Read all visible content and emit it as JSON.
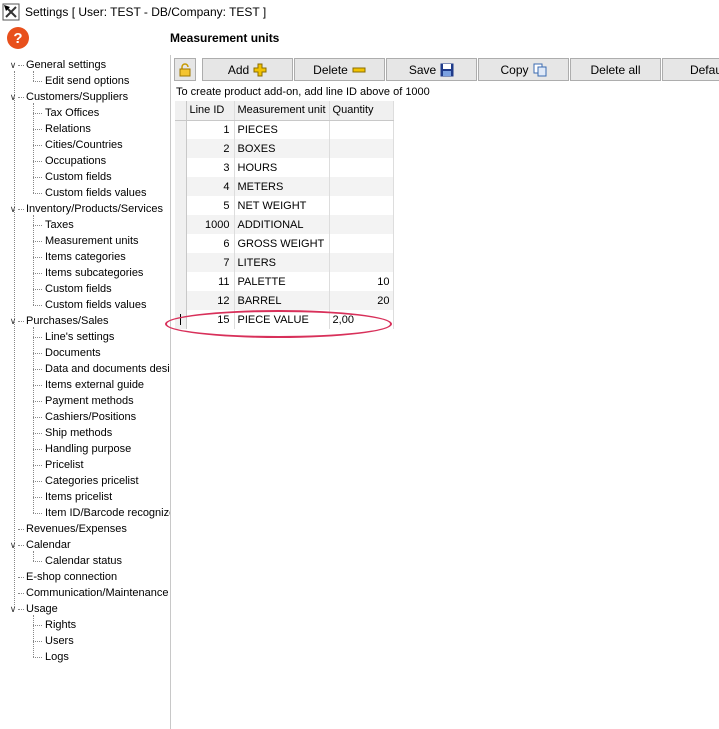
{
  "window": {
    "title": "Settings   [ User: TEST - DB/Company: TEST ]",
    "help_glyph": "?"
  },
  "tree": [
    {
      "label": "General settings",
      "level": 0,
      "toggle": "∨"
    },
    {
      "label": "Edit send options",
      "level": 1
    },
    {
      "label": "Customers/Suppliers",
      "level": 0,
      "toggle": "∨"
    },
    {
      "label": "Tax Offices",
      "level": 1
    },
    {
      "label": "Relations",
      "level": 1
    },
    {
      "label": "Cities/Countries",
      "level": 1
    },
    {
      "label": "Occupations",
      "level": 1
    },
    {
      "label": "Custom fields",
      "level": 1
    },
    {
      "label": "Custom fields values",
      "level": 1
    },
    {
      "label": "Inventory/Products/Services",
      "level": 0,
      "toggle": "∨"
    },
    {
      "label": "Taxes",
      "level": 1
    },
    {
      "label": "Measurement units",
      "level": 1
    },
    {
      "label": "Items categories",
      "level": 1
    },
    {
      "label": "Items subcategories",
      "level": 1
    },
    {
      "label": "Custom fields",
      "level": 1
    },
    {
      "label": "Custom fields values",
      "level": 1
    },
    {
      "label": "Purchases/Sales",
      "level": 0,
      "toggle": "∨"
    },
    {
      "label": "Line's settings",
      "level": 1
    },
    {
      "label": "Documents",
      "level": 1
    },
    {
      "label": "Data and documents desi",
      "level": 1
    },
    {
      "label": "Items external guide",
      "level": 1
    },
    {
      "label": "Payment methods",
      "level": 1
    },
    {
      "label": "Cashiers/Positions",
      "level": 1
    },
    {
      "label": "Ship methods",
      "level": 1
    },
    {
      "label": "Handling purpose",
      "level": 1
    },
    {
      "label": "Pricelist",
      "level": 1
    },
    {
      "label": "Categories pricelist",
      "level": 1
    },
    {
      "label": "Items pricelist",
      "level": 1
    },
    {
      "label": "Item ID/Barcode recognize",
      "level": 1
    },
    {
      "label": "Revenues/Expenses",
      "level": 0
    },
    {
      "label": "Calendar",
      "level": 0,
      "toggle": "∨"
    },
    {
      "label": "Calendar status",
      "level": 1
    },
    {
      "label": "E-shop connection",
      "level": 0
    },
    {
      "label": "Communication/Maintenance",
      "level": 0
    },
    {
      "label": "Usage",
      "level": 0,
      "toggle": "∨"
    },
    {
      "label": "Rights",
      "level": 1
    },
    {
      "label": "Users",
      "level": 1
    },
    {
      "label": "Logs",
      "level": 1
    }
  ],
  "panel": {
    "title": "Measurement units",
    "hint": "To create product add-on, add line ID above of 1000"
  },
  "toolbar": {
    "add": "Add",
    "delete": "Delete",
    "save": "Save",
    "copy": "Copy",
    "delete_all": "Delete all",
    "default": "Defau"
  },
  "grid": {
    "columns": [
      "Line ID",
      "Measurement unit",
      "Quantity"
    ],
    "rows": [
      {
        "id": "1",
        "unit": "PIECES",
        "qty": ""
      },
      {
        "id": "2",
        "unit": "BOXES",
        "qty": ""
      },
      {
        "id": "3",
        "unit": "HOURS",
        "qty": ""
      },
      {
        "id": "4",
        "unit": "METERS",
        "qty": ""
      },
      {
        "id": "5",
        "unit": "NET WEIGHT",
        "qty": ""
      },
      {
        "id": "1000",
        "unit": "ADDITIONAL",
        "qty": ""
      },
      {
        "id": "6",
        "unit": "GROSS WEIGHT",
        "qty": ""
      },
      {
        "id": "7",
        "unit": "LITERS",
        "qty": ""
      },
      {
        "id": "11",
        "unit": "PALETTE",
        "qty": "10"
      },
      {
        "id": "12",
        "unit": "BARREL",
        "qty": "20"
      },
      {
        "id": "15",
        "unit": "PIECE VALUE",
        "qty": "2,00",
        "editing": true
      }
    ]
  },
  "colors": {
    "highlight": "#d8305a",
    "help": "#e8501c",
    "add_icon": "#f2c200",
    "save_icon": "#1f3b8a"
  }
}
